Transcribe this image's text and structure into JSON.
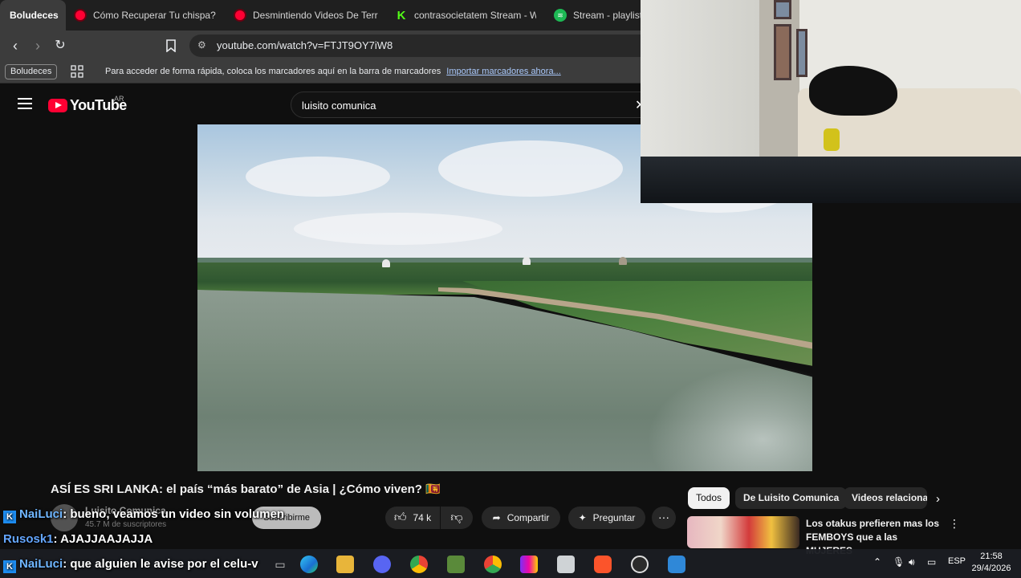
{
  "browser": {
    "tabs": [
      {
        "label": "Boludeces",
        "active": true
      },
      {
        "label": "Cómo Recuperar Tu chispa? - Y",
        "icon": "youtube-icon"
      },
      {
        "label": "Desmintiendo Videos De Terro",
        "icon": "youtube-icon"
      },
      {
        "label": "contrasocietatem Stream - Wat",
        "icon": "kick-icon"
      },
      {
        "label": "Stream - playlist l",
        "icon": "spotify-icon"
      }
    ],
    "url": "youtube.com/watch?v=FTJT9OY7iW8",
    "bookmarks_folder": "Boludeces",
    "bookmarks_hint": "Para acceder de forma rápida, coloca los marcadores aquí en la barra de marcadores",
    "bookmarks_link": "Importar marcadores ahora..."
  },
  "youtube": {
    "logo_text": "YouTube",
    "country": "AR",
    "search_value": "luisito comunica",
    "video_title": "ASÍ ES SRI LANKA: el país “más barato” de Asia | ¿Cómo viven? 🇱🇰",
    "channel_name": "Luisito Comunica",
    "subscribers": "45.7 M de suscriptores",
    "subscribe_label": "Suscribirme",
    "likes": "74 k",
    "share_label": "Compartir",
    "ask_label": "Preguntar",
    "chips": [
      "Todos",
      "De Luisito Comunica",
      "Videos relaciona"
    ],
    "related": [
      {
        "title": "Los otakus prefieren mas los FEMBOYS que a las MUJERES"
      }
    ]
  },
  "chat": [
    {
      "user": "NaiLuci",
      "message": ": bueno, veamos un video sin volumen"
    },
    {
      "user": "Rusosk1",
      "message": ": AJAJJAAJAJJA"
    },
    {
      "user": "NaiLuci",
      "message": ": que alguien le avise por el celu-v"
    }
  ],
  "taskbar": {
    "language": "ESP",
    "time": "21:58",
    "date": "29/4/2026"
  },
  "colors": {
    "youtube_red": "#ff0033",
    "chrome_bg": "#3c3c3c",
    "page_bg": "#0f0f0f",
    "chat_username": "#6fb6ff"
  }
}
